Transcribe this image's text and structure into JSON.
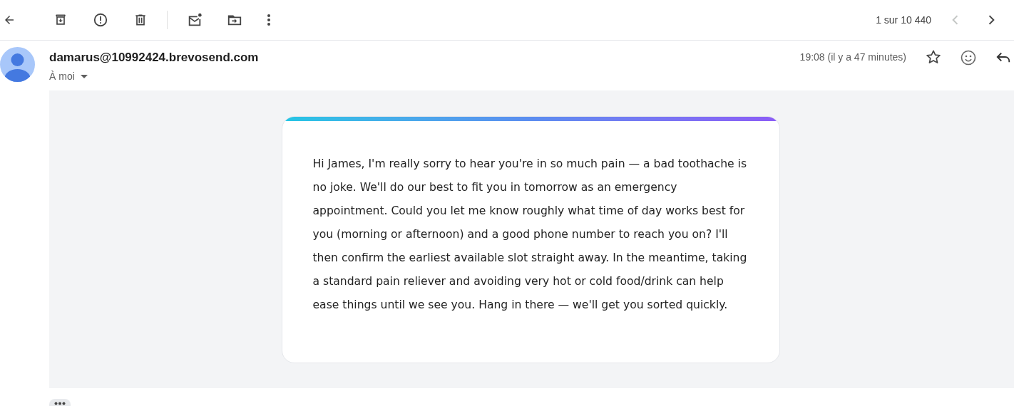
{
  "toolbar": {
    "pager": "1 sur 10 440",
    "pager_buttons": [
      {
        "kind": "prev",
        "disabled": true
      },
      {
        "kind": "next",
        "disabled": false
      }
    ]
  },
  "message": {
    "sender": "damarus@10992424.brevosend.com",
    "recipient": "À moi",
    "time": "19:08 (il y a 47 minutes)",
    "starred": false,
    "body": "Hi James, I'm really sorry to hear you're in so much pain — a bad toothache is no joke. We'll do our best to fit you in tomorrow as an emergency appointment. Could you let me know roughly what time of day works best for you (morning or afternoon) and a good phone number to reach you on? I'll then confirm the earliest available slot straight away. In the meantime, taking a standard pain reliever and avoiding very hot or cold food/drink can help ease things until we see you. Hang in there — we'll get you sorted quickly."
  }
}
